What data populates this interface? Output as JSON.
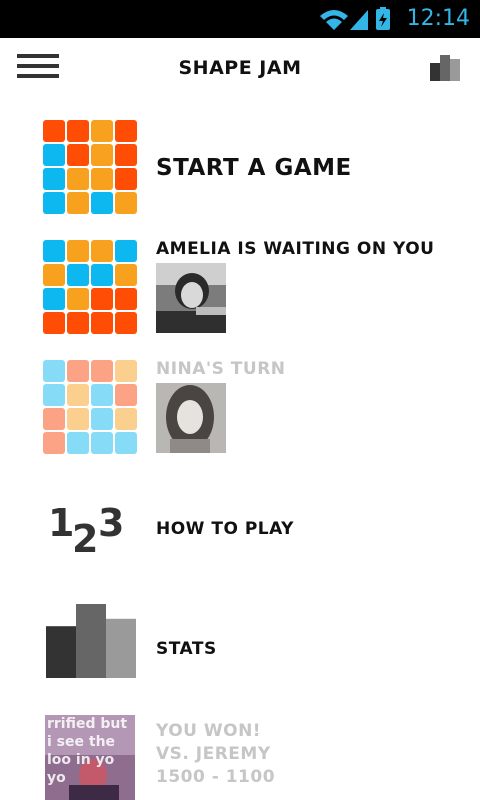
{
  "status_bar": {
    "time": "12:14",
    "icons": [
      "wifi-icon",
      "signal-icon",
      "battery-charging-icon"
    ],
    "accent": "#33b5e5"
  },
  "app_bar": {
    "title": "SHAPE JAM",
    "menu_icon": "hamburger-menu-icon",
    "stats_icon": "bar-chart-icon"
  },
  "colors": {
    "orange": "#f7a11f",
    "red": "#ff4d06",
    "blue": "#0db8f0",
    "faded_orange": "#fbd08f",
    "faded_red": "#fda385",
    "faded_blue": "#86dcf7",
    "dark": "#333333"
  },
  "menu": {
    "start_game": {
      "label": "START A GAME",
      "grid": [
        "R",
        "R",
        "O",
        "R",
        "B",
        "R",
        "O",
        "R",
        "B",
        "O",
        "O",
        "R",
        "B",
        "O",
        "B",
        "O"
      ]
    },
    "waiting_game": {
      "label": "AMELIA IS WAITING ON YOU",
      "grid": [
        "B",
        "O",
        "O",
        "B",
        "O",
        "B",
        "B",
        "O",
        "B",
        "O",
        "R",
        "R",
        "R",
        "R",
        "R",
        "R"
      ]
    },
    "nina_game": {
      "label": "NINA'S TURN",
      "grid": [
        "B",
        "R",
        "R",
        "O",
        "B",
        "O",
        "B",
        "R",
        "R",
        "O",
        "B",
        "O",
        "R",
        "B",
        "B",
        "B"
      ]
    },
    "how_to_play": {
      "label": "HOW TO PLAY",
      "digits": [
        "1",
        "2",
        "3"
      ]
    },
    "stats": {
      "label": "STATS",
      "bars": [
        0.7,
        1.0,
        0.8
      ]
    },
    "result": {
      "line1": "YOU WON!",
      "line2": "VS. JEREMY",
      "line3": "1500 - 1100",
      "photo_caption": "rrified but i see the loo in yo yo"
    }
  }
}
